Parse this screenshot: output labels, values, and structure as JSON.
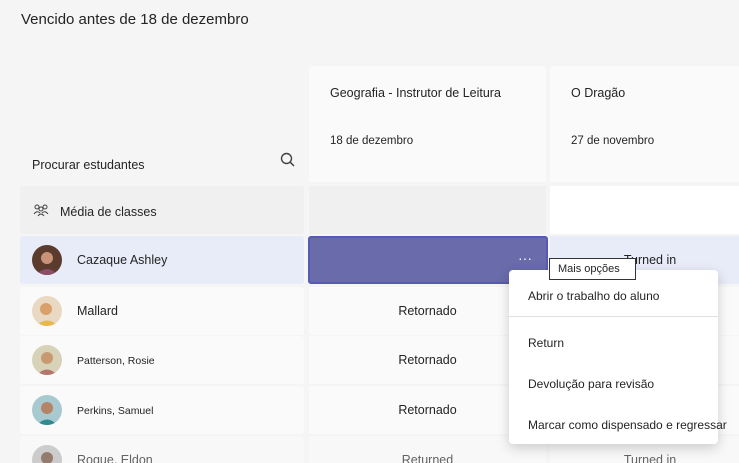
{
  "header": {
    "title": "Vencido antes de 18 de dezembro"
  },
  "columns": [
    {
      "name": "Geografia - Instrutor de Leitura",
      "date": "18 de dezembro"
    },
    {
      "name": "O Dragão",
      "date": "27 de novembro"
    }
  ],
  "search": {
    "label": "Procurar estudantes"
  },
  "average": {
    "label": "Média de classes"
  },
  "students": [
    {
      "name": "Cazaque Ashley",
      "col1": "",
      "col2": "Turned in"
    },
    {
      "name": "Mallard",
      "col1": "Retornado",
      "col2": ""
    },
    {
      "name": "Patterson, Rosie",
      "col1": "Retornado",
      "col2": ""
    },
    {
      "name": "Perkins, Samuel",
      "col1": "Retornado",
      "col2": ""
    },
    {
      "name": "Rogue, Eldon",
      "col1": "Returned",
      "col2": "Turned in"
    }
  ],
  "tooltip": {
    "text": "Mais opções"
  },
  "menu": {
    "items": [
      "Abrir o trabalho do aluno",
      "Return",
      "Devolução para revisão",
      "Marcar como dispensado e regressar"
    ]
  },
  "colors": {
    "accent": "#6264a7",
    "selected_row": "#e8ebf8"
  }
}
